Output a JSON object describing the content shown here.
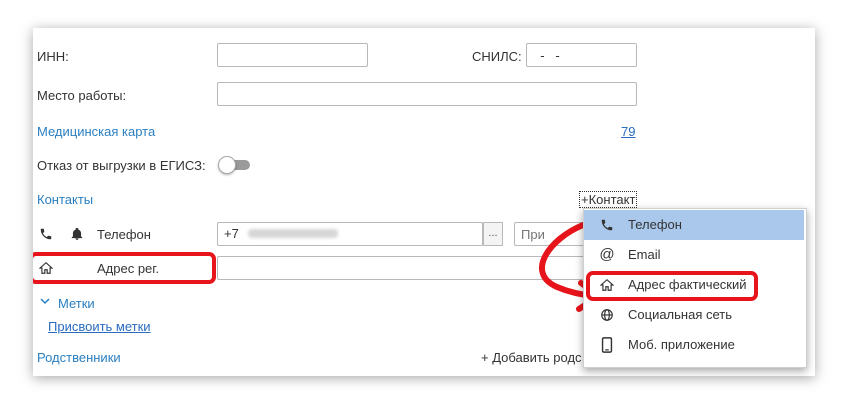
{
  "form": {
    "inn_label": "ИНН:",
    "inn_value": "",
    "snils_label": "СНИЛС:",
    "snils_value": "  -   -",
    "workplace_label": "Место работы:",
    "workplace_value": "",
    "medcard_label": "Медицинская карта",
    "medcard_value": "79",
    "egisz_label": "Отказ от выгрузки в ЕГИСЗ:",
    "egisz_enabled": false
  },
  "contacts": {
    "section_title": "Контакты",
    "add_contact_label": "+Контакт",
    "phone_label": "Телефон",
    "phone_prefix": "+7",
    "phone_value": "(",
    "phone_dots": "...",
    "phone_extra_placeholder": "При",
    "address_label": "Адрес рег.",
    "address_value": ""
  },
  "tags": {
    "section_title": "Метки",
    "assign_label": "Присвоить метки"
  },
  "relatives": {
    "section_title": "Родственники",
    "add_label": "+ Добавить родс"
  },
  "contact_menu": {
    "items": [
      {
        "label": "Телефон",
        "icon": "phone-icon",
        "selected": true
      },
      {
        "label": "Email",
        "icon": "at-icon",
        "selected": false
      },
      {
        "label": "Адрес фактический",
        "icon": "house-icon",
        "selected": false
      },
      {
        "label": "Социальная сеть",
        "icon": "globe-icon",
        "selected": false
      },
      {
        "label": "Моб. приложение",
        "icon": "mobile-icon",
        "selected": false
      }
    ]
  },
  "colors": {
    "link": "#2a7fc1",
    "selected_item": "#a9c8eb",
    "annotation_red": "#e8141b"
  }
}
